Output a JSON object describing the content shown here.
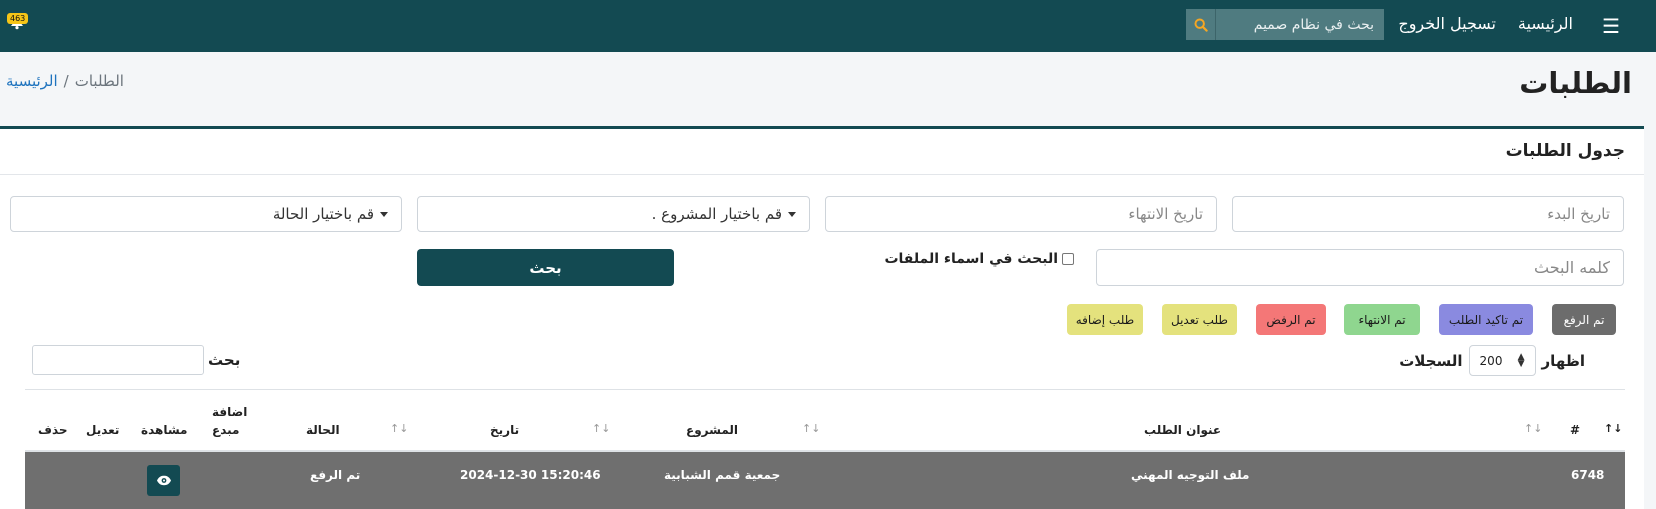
{
  "navbar": {
    "home_label": "الرئيسية",
    "logout_label": "تسجيل الخروج",
    "search_placeholder": "بحث في نظام صميم",
    "notification_count": "463"
  },
  "page": {
    "title": "الطلبات",
    "breadcrumb": {
      "home": "الرئيسية",
      "separator": "/",
      "current": "الطلبات"
    }
  },
  "card": {
    "title": "جدول الطلبات",
    "filters": {
      "start_date_placeholder": "تاريخ البدء",
      "end_date_placeholder": "تاريخ الانتهاء",
      "project_select": ". قم باختيار المشروع",
      "status_select": "قم باختيار الحالة",
      "keyword_placeholder": "كلمه البحث",
      "filenames_checkbox_label": "البحث في اسماء الملفات",
      "search_button": "بحث"
    },
    "status_buttons": [
      {
        "label": "تم الرفع",
        "color": "#6c6c6c",
        "text_color": "#ffffff"
      },
      {
        "label": "تم تاكيد الطلب",
        "color": "#8a8ae0",
        "text_color": "#1a1a1a"
      },
      {
        "label": "تم الانتهاء",
        "color": "#8fd68f",
        "text_color": "#1a1a1a"
      },
      {
        "label": "تم الرفض",
        "color": "#f47777",
        "text_color": "#1a1a1a"
      },
      {
        "label": "طلب تعديل",
        "color": "#e4e27d",
        "text_color": "#1a1a1a"
      },
      {
        "label": "طلب إضافه",
        "color": "#e4e27d",
        "text_color": "#1a1a1a"
      }
    ],
    "table": {
      "show_label": "اظهار",
      "page_size": "200",
      "records_label": "السجلات",
      "search_label": "بحث",
      "columns": {
        "number": "#",
        "title": "عنوان الطلب",
        "project": "المشروع",
        "date": "تاريخ",
        "status": "الحالة",
        "add_creative_line1": "اضافة",
        "add_creative_line2": "مبدع",
        "view": "مشاهدة",
        "edit": "تعديل",
        "delete": "حذف"
      },
      "rows": [
        {
          "id": "6748",
          "title": "ملف التوجيه المهني",
          "project": "جمعية قمم الشبابية",
          "date": "2024-12-30 15:20:46",
          "status": "تم الرفع"
        }
      ]
    }
  },
  "colors": {
    "brand": "#134a52",
    "link": "#1e73be",
    "row_uploaded": "#6f6f6f"
  }
}
